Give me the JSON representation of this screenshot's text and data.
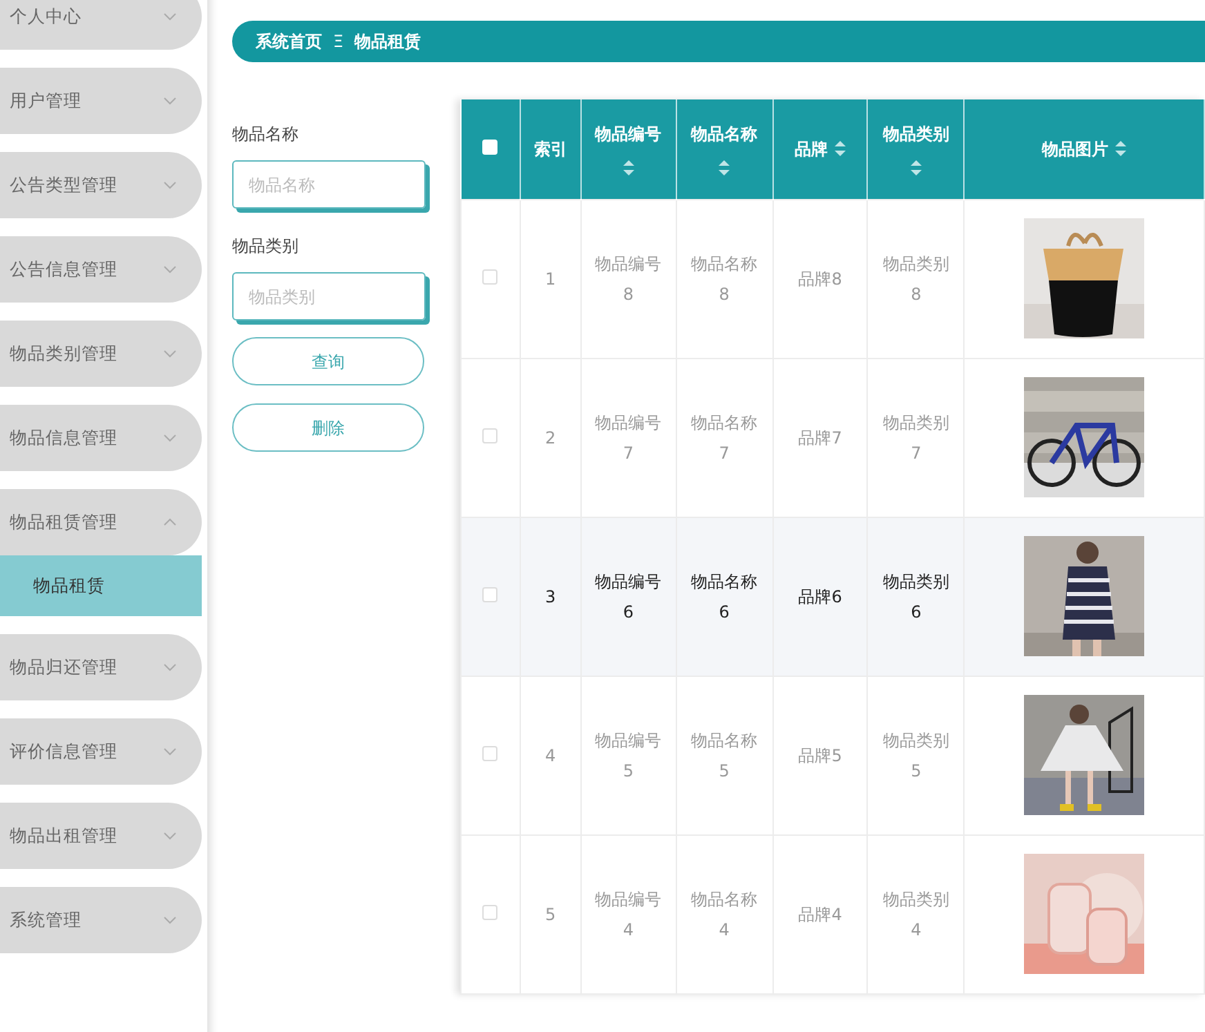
{
  "sidebar": {
    "items": [
      {
        "label": "个人中心",
        "expanded": false
      },
      {
        "label": "用户管理",
        "expanded": false
      },
      {
        "label": "公告类型管理",
        "expanded": false
      },
      {
        "label": "公告信息管理",
        "expanded": false
      },
      {
        "label": "物品类别管理",
        "expanded": false
      },
      {
        "label": "物品信息管理",
        "expanded": false
      },
      {
        "label": "物品租赁管理",
        "expanded": true,
        "children": [
          {
            "label": "物品租赁",
            "selected": true
          }
        ]
      },
      {
        "label": "物品归还管理",
        "expanded": false
      },
      {
        "label": "评价信息管理",
        "expanded": false
      },
      {
        "label": "物品出租管理",
        "expanded": false
      },
      {
        "label": "系统管理",
        "expanded": false
      }
    ]
  },
  "breadcrumb": {
    "home": "系统首页",
    "separator": "Ξ",
    "current": "物品租赁"
  },
  "search": {
    "fields": [
      {
        "label": "物品名称",
        "placeholder": "物品名称"
      },
      {
        "label": "物品类别",
        "placeholder": "物品类别"
      }
    ],
    "buttons": [
      "查询",
      "删除"
    ]
  },
  "table": {
    "select_all_checked": false,
    "columns": [
      {
        "label": "索引",
        "sortable": false
      },
      {
        "label": "物品编号",
        "sortable": true
      },
      {
        "label": "物品名称",
        "sortable": true
      },
      {
        "label": "品牌",
        "sortable": true
      },
      {
        "label": "物品类别",
        "sortable": true
      },
      {
        "label": "物品图片",
        "sortable": true
      }
    ],
    "rows": [
      {
        "checked": false,
        "highlighted": false,
        "cells": [
          "1",
          "物品编号\n8",
          "物品名称\n8",
          "品牌8",
          "物品类别\n8"
        ],
        "image": {
          "kind": "picture"
        }
      },
      {
        "checked": false,
        "highlighted": false,
        "cells": [
          "2",
          "物品编号\n7",
          "物品名称\n7",
          "品牌7",
          "物品类别\n7"
        ],
        "image": {
          "kind": "picture"
        }
      },
      {
        "checked": false,
        "highlighted": true,
        "cells": [
          "3",
          "物品编号\n6",
          "物品名称\n6",
          "品牌6",
          "物品类别\n6"
        ],
        "image": {
          "kind": "picture"
        }
      },
      {
        "checked": false,
        "highlighted": false,
        "cells": [
          "4",
          "物品编号\n5",
          "物品名称\n5",
          "品牌5",
          "物品类别\n5"
        ],
        "image": {
          "kind": "picture"
        }
      },
      {
        "checked": false,
        "highlighted": false,
        "cells": [
          "5",
          "物品编号\n4",
          "物品名称\n4",
          "品牌4",
          "物品类别\n4"
        ],
        "image": {
          "kind": "picture"
        }
      }
    ]
  }
}
